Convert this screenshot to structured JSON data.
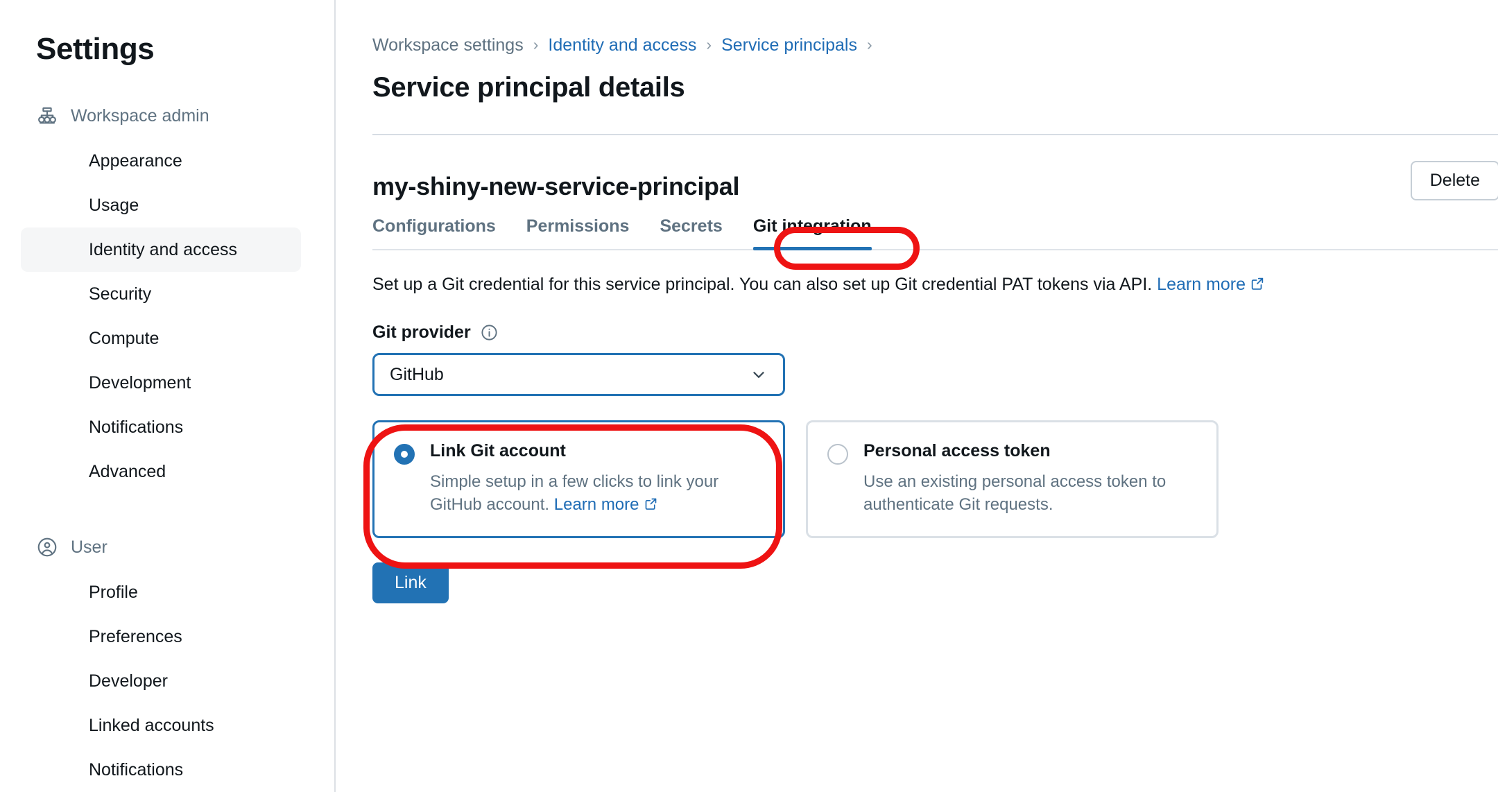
{
  "sidebar": {
    "title": "Settings",
    "groups": [
      {
        "header": {
          "label": "Workspace admin",
          "icon": "org-hierarchy-icon"
        },
        "items": [
          {
            "label": "Appearance",
            "active": false
          },
          {
            "label": "Usage",
            "active": false
          },
          {
            "label": "Identity and access",
            "active": true
          },
          {
            "label": "Security",
            "active": false
          },
          {
            "label": "Compute",
            "active": false
          },
          {
            "label": "Development",
            "active": false
          },
          {
            "label": "Notifications",
            "active": false
          },
          {
            "label": "Advanced",
            "active": false
          }
        ]
      },
      {
        "header": {
          "label": "User",
          "icon": "user-circle-icon"
        },
        "items": [
          {
            "label": "Profile",
            "active": false
          },
          {
            "label": "Preferences",
            "active": false
          },
          {
            "label": "Developer",
            "active": false
          },
          {
            "label": "Linked accounts",
            "active": false
          },
          {
            "label": "Notifications",
            "active": false
          }
        ]
      }
    ]
  },
  "main": {
    "breadcrumb": [
      {
        "label": "Workspace settings",
        "link": false
      },
      {
        "label": "Identity and access",
        "link": true
      },
      {
        "label": "Service principals",
        "link": true
      }
    ],
    "breadcrumb_separator": "›",
    "page_title": "Service principal details",
    "service_principal_name": "my-shiny-new-service-principal",
    "delete_label": "Delete",
    "tabs": [
      {
        "label": "Configurations",
        "active": false
      },
      {
        "label": "Permissions",
        "active": false
      },
      {
        "label": "Secrets",
        "active": false
      },
      {
        "label": "Git integration",
        "active": true
      }
    ],
    "description": {
      "text": "Set up a Git credential for this service principal. You can also set up Git credential PAT tokens via API.",
      "link_label": "Learn more"
    },
    "git_provider": {
      "label": "Git provider",
      "info_icon": "info-circle-icon",
      "selected": "GitHub",
      "options": [
        "GitHub"
      ]
    },
    "auth_options": [
      {
        "title": "Link Git account",
        "description": "Simple setup in a few clicks to link your GitHub account.",
        "link_label": "Learn more",
        "selected": true
      },
      {
        "title": "Personal access token",
        "description": "Use an existing personal access token to authenticate Git requests.",
        "link_label": "",
        "selected": false
      }
    ],
    "submit_label": "Link"
  },
  "annotations": {
    "accent_color": "#ee1313",
    "highlights": [
      "git-integration-tab",
      "link-git-account-card"
    ]
  },
  "colors": {
    "brand_blue": "#2272b4",
    "link_blue": "#1f6cb5",
    "text_primary": "#11171c",
    "text_muted": "#5f7281",
    "annotation_red": "#ee1313"
  }
}
